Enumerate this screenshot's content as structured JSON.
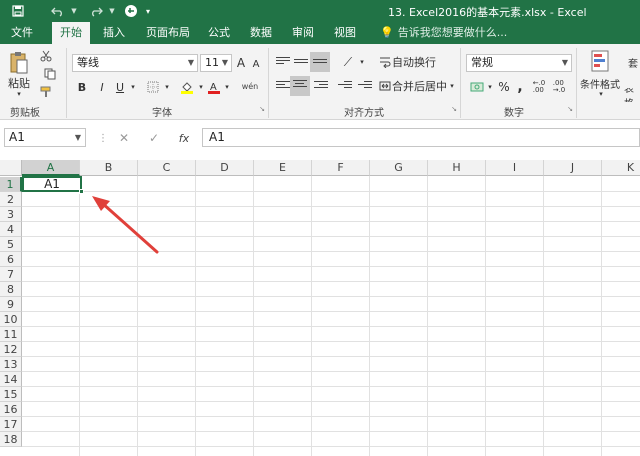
{
  "window": {
    "title": "13. Excel2016的基本元素.xlsx - Excel",
    "quick_access": {
      "save_icon": "save-icon",
      "undo_icon": "undo-icon",
      "redo_icon": "redo-icon",
      "touch_icon": "touch-mode-icon"
    }
  },
  "tabs": [
    {
      "label": "文件"
    },
    {
      "label": "开始"
    },
    {
      "label": "插入"
    },
    {
      "label": "页面布局"
    },
    {
      "label": "公式"
    },
    {
      "label": "数据"
    },
    {
      "label": "审阅"
    },
    {
      "label": "视图"
    }
  ],
  "active_tab": "开始",
  "tell_me": "告诉我您想要做什么...",
  "ribbon": {
    "clipboard": {
      "paste_label": "粘贴",
      "group_label": "剪贴板"
    },
    "font": {
      "font_name": "等线",
      "font_size": "11",
      "bold": "B",
      "italic": "I",
      "underline": "U",
      "grow": "A",
      "shrink": "A",
      "phonetic": "wén",
      "group_label": "字体"
    },
    "alignment": {
      "wrap_text": "自动换行",
      "merge_center": "合并后居中",
      "group_label": "对齐方式"
    },
    "number": {
      "format": "常规",
      "percent": "%",
      "comma": ",",
      "group_label": "数字"
    },
    "styles": {
      "conditional_format": "条件格式",
      "table_format_partial": "表格"
    }
  },
  "formula_bar": {
    "name_box": "A1",
    "cancel": "✕",
    "enter": "✓",
    "fx": "fx",
    "content": "A1"
  },
  "sheet": {
    "columns": [
      "A",
      "B",
      "C",
      "D",
      "E",
      "F",
      "G",
      "H",
      "I",
      "J",
      "K"
    ],
    "rows": [
      "1",
      "2",
      "3",
      "4",
      "5",
      "6",
      "7",
      "8",
      "9",
      "10",
      "11",
      "12",
      "13",
      "14",
      "15",
      "16",
      "17",
      "18"
    ],
    "selected_cell": "A1",
    "cell_a1": "A1"
  },
  "colors": {
    "accent": "#217346",
    "annotation_arrow": "#e0403a"
  }
}
